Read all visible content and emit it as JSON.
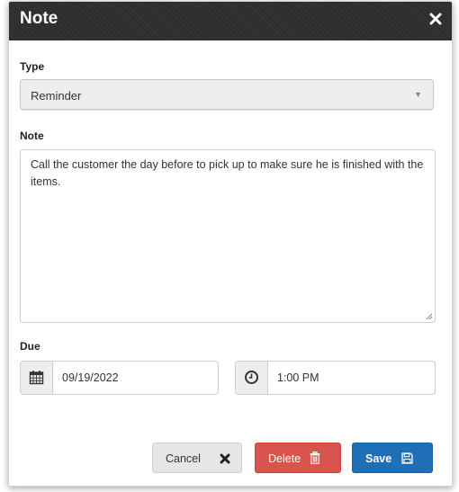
{
  "dialog": {
    "title": "Note",
    "close_icon": "close-icon"
  },
  "type_field": {
    "label": "Type",
    "value": "Reminder"
  },
  "note_field": {
    "label": "Note",
    "value": "Call the customer the day before to pick up to make sure he is finished with the items."
  },
  "due": {
    "label": "Due",
    "date": "09/19/2022",
    "time": "1:00 PM",
    "date_icon": "calendar-icon",
    "time_icon": "clock-icon"
  },
  "buttons": {
    "cancel": "Cancel",
    "delete": "Delete",
    "save": "Save"
  },
  "colors": {
    "titlebar": "#2d2d2d",
    "delete": "#d9534f",
    "save": "#1f6fb7",
    "cancel": "#e6e6e6"
  }
}
